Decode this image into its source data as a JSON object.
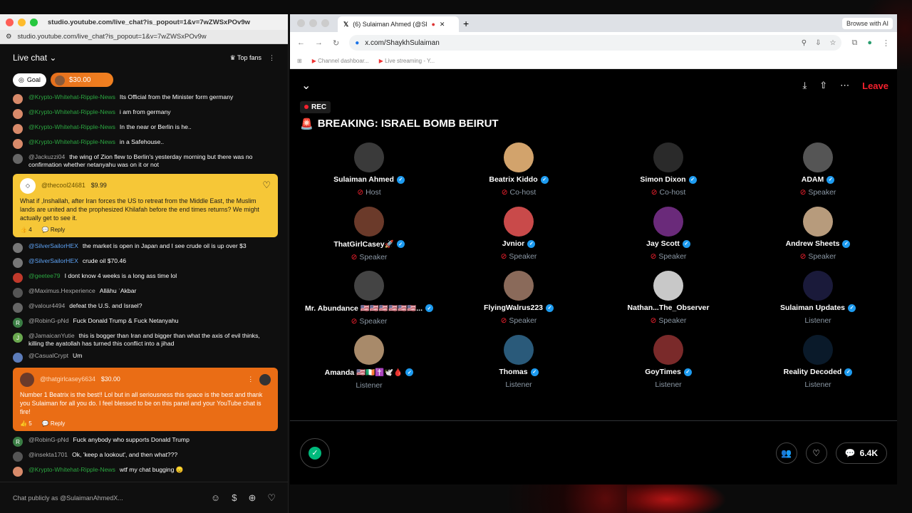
{
  "left_window": {
    "title": "studio.youtube.com/live_chat?is_popout=1&v=7wZWSxPOv9w",
    "url": "studio.youtube.com/live_chat?is_popout=1&v=7wZWSxPOv9w",
    "header": {
      "title": "Live chat",
      "top_fans": "Top fans"
    },
    "goal": {
      "label": "Goal",
      "amount": "$30.00"
    },
    "messages_a": [
      {
        "author": "@Krypto-Whitehat-Ripple-News",
        "text": "Its Official from the Minister form germany",
        "style": "green",
        "avcolor": "#d88a6a"
      },
      {
        "author": "@Krypto-Whitehat-Ripple-News",
        "text": "i am from germany",
        "style": "green",
        "avcolor": "#d88a6a"
      },
      {
        "author": "@Krypto-Whitehat-Ripple-News",
        "text": "In the near or Berlin is he..",
        "style": "green",
        "avcolor": "#d88a6a"
      },
      {
        "author": "@Krypto-Whitehat-Ripple-News",
        "text": "in a Safehouse..",
        "style": "green",
        "avcolor": "#d88a6a"
      },
      {
        "author": "@Jackuzzi04",
        "text": "the wing of Zion flew to Berlin's yesterday morning but there was no confirmation whether netanyahu was on it or not",
        "style": "gray",
        "avcolor": "#666"
      }
    ],
    "superchat_1": {
      "author": "@thecool24681",
      "amount": "$9.99",
      "text": "What if ,Inshallah, after Iran forces the US to retreat from the Middle East, the Muslim lands are united and the prophesized Khilafah before the end times returns? We might actually get to see it.",
      "likes": "4",
      "reply": "Reply"
    },
    "messages_b": [
      {
        "author": "@SilverSailorHEX",
        "text": "the market is open in Japan and I see crude oil is up over $3",
        "style": "blue",
        "avcolor": "#777"
      },
      {
        "author": "@SilverSailorHEX",
        "text": "crude oil $70.46",
        "style": "blue",
        "avcolor": "#777"
      },
      {
        "author": "@geetee79",
        "text": "I dont know 4 weeks is a long ass time lol",
        "style": "green",
        "avcolor": "#c0392b"
      },
      {
        "author": "@Maximus.Hexperience",
        "text": "Allāhu ʾAkbar",
        "style": "gray",
        "avcolor": "#555"
      },
      {
        "author": "@valour4494",
        "text": "defeat the U.S. and Israel?",
        "style": "gray",
        "avcolor": "#666"
      },
      {
        "author": "@RobinG-pNd",
        "text": "Fuck Donald Trump & Fuck Netanyahu",
        "style": "gray",
        "avcolor": "#3a7d44",
        "initial": "R"
      },
      {
        "author": "@JamaicanYutie",
        "text": "this is bogger than Iran and bigger than what the axis of evil thinks, killing the ayatollah has turned this conflict into a jihad",
        "style": "gray",
        "avcolor": "#6aa84f",
        "initial": "J"
      },
      {
        "author": "@CasualCrypt",
        "text": "Um",
        "style": "gray",
        "avcolor": "#5c7cba"
      }
    ],
    "superchat_2": {
      "author": "@thatgirlcasey6634",
      "amount": "$30.00",
      "text": "Number 1 Beatrix is the best!! Lol but in all seriousness this space is the best and thank you Sulaiman for all you do. I feel blessed to be on this panel and your YouTube chat is fire!",
      "likes": "5",
      "reply": "Reply"
    },
    "messages_c": [
      {
        "author": "@RobinG-pNd",
        "text": "Fuck anybody who supports Donald Trump",
        "style": "gray",
        "avcolor": "#3a7d44",
        "initial": "R"
      },
      {
        "author": "@insekta1701",
        "text": "Ok, 'keep a lookout', and then what???",
        "style": "gray",
        "avcolor": "#555"
      },
      {
        "author": "@Krypto-Whitehat-Ripple-News",
        "text": "wtf my chat bugging 😞",
        "style": "green",
        "avcolor": "#d88a6a"
      }
    ],
    "compose_placeholder": "Chat publicly as @SulaimanAhmedX..."
  },
  "right_window": {
    "tab_title": "(6) Sulaiman Ahmed (@Sl",
    "browse_ai": "Browse with AI",
    "url": "x.com/ShaykhSulaiman",
    "bookmarks": [
      "Channel dashboar...",
      "Live streaming - Y..."
    ],
    "space": {
      "rec": "REC",
      "title": "BREAKING: ISRAEL BOMB BEIRUT",
      "leave": "Leave",
      "count": "6.4K",
      "participants": [
        {
          "name": "Sulaiman Ahmed",
          "role": "Host",
          "verified": true,
          "color": "#3a3a3a"
        },
        {
          "name": "Beatrix Kiddo",
          "role": "Co-host",
          "verified": true,
          "color": "#d2a36c"
        },
        {
          "name": "Simon Dixon",
          "role": "Co-host",
          "verified": true,
          "color": "#2a2a2a"
        },
        {
          "name": "ADAM",
          "role": "Speaker",
          "verified": true,
          "color": "#555"
        },
        {
          "name": "ThatGirlCasey🚀",
          "role": "Speaker",
          "verified": true,
          "color": "#6b3a2a"
        },
        {
          "name": "Jvnior",
          "role": "Speaker",
          "verified": true,
          "color": "#c94a4a"
        },
        {
          "name": "Jay Scott",
          "role": "Speaker",
          "verified": true,
          "color": "#6a2a7a"
        },
        {
          "name": "Andrew Sheets",
          "role": "Speaker",
          "verified": true,
          "color": "#b79b7c"
        },
        {
          "name": "Mr. Abundance 🇺🇸🇺🇸🇺🇸🇺🇸🇺🇸🇺🇸...",
          "role": "Speaker",
          "verified": true,
          "color": "#444"
        },
        {
          "name": "FlyingWalrus223",
          "role": "Speaker",
          "verified": true,
          "color": "#8a6a5a"
        },
        {
          "name": "Nathan...The_Observer",
          "role": "Speaker",
          "verified": false,
          "color": "#c8c8c8"
        },
        {
          "name": "Sulaiman Updates",
          "role": "Listener",
          "verified": true,
          "color": "#1a1a3a"
        },
        {
          "name": "Amanda 🇺🇸🇮🇪✝️🕊️🩸",
          "role": "Listener",
          "verified": true,
          "color": "#a88a6a"
        },
        {
          "name": "Thomas",
          "role": "Listener",
          "verified": true,
          "color": "#2a5a7a"
        },
        {
          "name": "GoyTimes",
          "role": "Listener",
          "verified": true,
          "color": "#7a2a2a"
        },
        {
          "name": "Reality Decoded",
          "role": "Listener",
          "verified": true,
          "color": "#0a1a2a"
        }
      ]
    }
  }
}
